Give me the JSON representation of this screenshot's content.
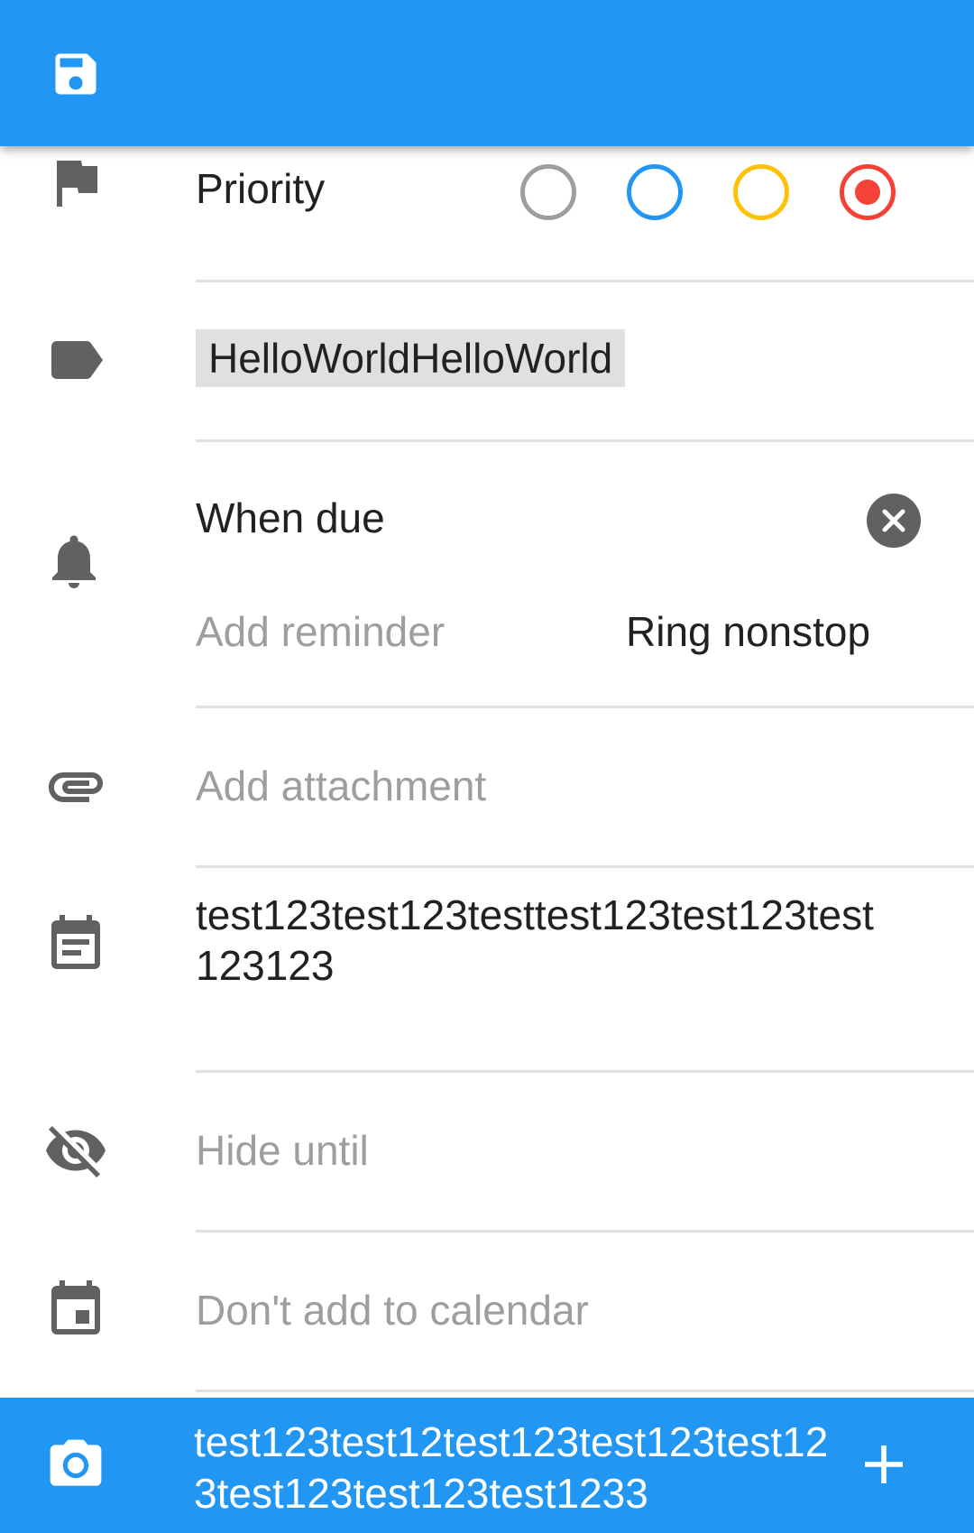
{
  "header": {
    "save_icon": "save-icon"
  },
  "priority": {
    "label": "Priority",
    "icon": "flag-icon",
    "options": [
      {
        "name": "none",
        "color": "#9e9e9e",
        "selected": false
      },
      {
        "name": "low",
        "color": "#2196F3",
        "selected": false
      },
      {
        "name": "medium",
        "color": "#FFC107",
        "selected": false
      },
      {
        "name": "high",
        "color": "#F44336",
        "selected": true
      }
    ]
  },
  "tags": {
    "icon": "label-icon",
    "chip": "HelloWorldHelloWorld"
  },
  "reminders": {
    "icon": "bell-icon",
    "when_due": "When due",
    "add_reminder": "Add reminder",
    "ring_mode": "Ring nonstop"
  },
  "attachment": {
    "icon": "paperclip-icon",
    "label": "Add attachment"
  },
  "description": {
    "icon": "notes-icon",
    "text": "test123test123testtest123test123test123123"
  },
  "hide_until": {
    "icon": "eye-off-icon",
    "label": "Hide until"
  },
  "calendar": {
    "icon": "calendar-icon",
    "label": "Don't add to calendar"
  },
  "comment_bar": {
    "icon": "camera-icon",
    "text": "test123test12test123test123test123test123test123test1233",
    "add_icon": "plus-icon"
  },
  "colors": {
    "primary": "#2196F3",
    "divider": "#e0e0e0",
    "hint": "#9e9e9e"
  }
}
